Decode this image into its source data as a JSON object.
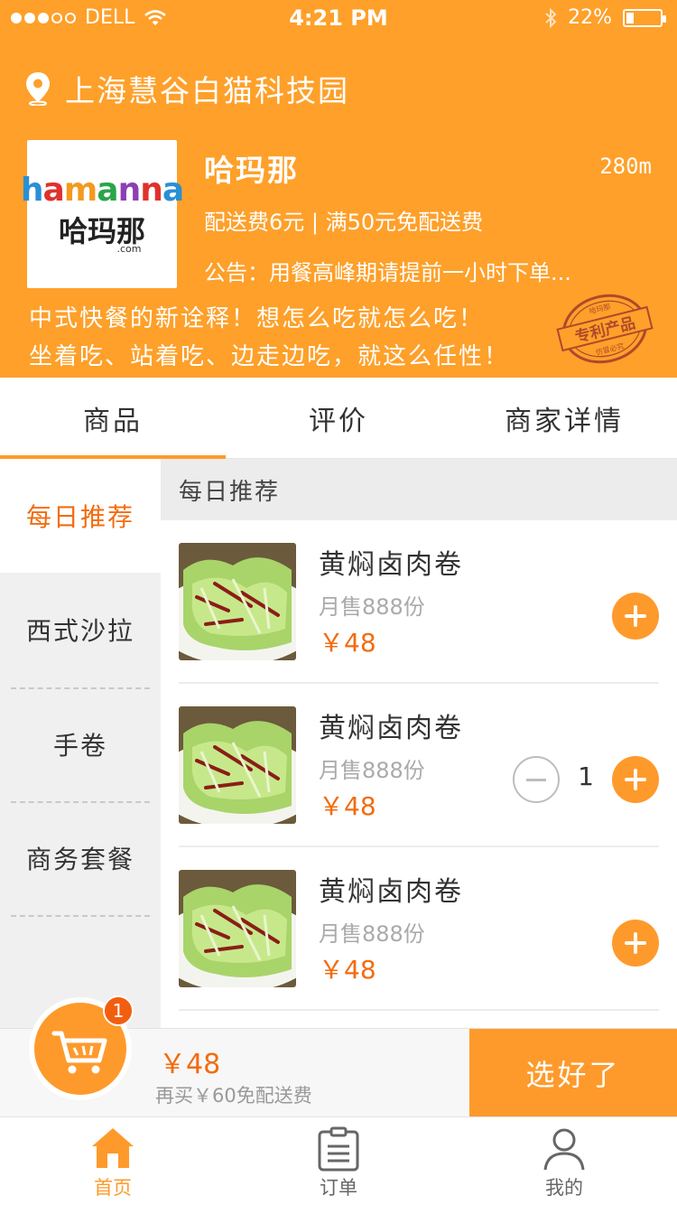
{
  "status_bar": {
    "carrier": "DELL",
    "time": "4:21 PM",
    "battery": "22%",
    "battery_level": 0.22,
    "signal_bars_filled": 3,
    "signal_bars_total": 5
  },
  "header": {
    "location": "上海慧谷白猫科技园",
    "shop": {
      "logo_text_latin": "hamanna",
      "logo_text_cn": "哈玛那",
      "logo_text_domain": ".com",
      "name": "哈玛那",
      "distance": "280m",
      "fee_info": "配送费6元 | 满50元免配送费",
      "notice": "公告：用餐高峰期请提前一小时下单..."
    },
    "slogan_line1": "中式快餐的新诠释！想怎么吃就怎么吃！",
    "slogan_line2": "坐着吃、站着吃、边走边吃，就这么任性！",
    "stamp_text": "专利产品",
    "stamp_small_top": "哈玛那",
    "stamp_small_bottom": "仿冒必究"
  },
  "tabs": [
    {
      "label": "商品",
      "active": true
    },
    {
      "label": "评价",
      "active": false
    },
    {
      "label": "商家详情",
      "active": false
    }
  ],
  "categories": [
    {
      "label": "每日推荐",
      "active": true
    },
    {
      "label": "西式沙拉",
      "active": false
    },
    {
      "label": "手卷",
      "active": false
    },
    {
      "label": "商务套餐",
      "active": false
    }
  ],
  "list": {
    "section_title": "每日推荐",
    "items": [
      {
        "name": "黄焖卤肉卷",
        "sold": "月售888份",
        "price": "￥48",
        "quantity": null
      },
      {
        "name": "黄焖卤肉卷",
        "sold": "月售888份",
        "price": "￥48",
        "quantity": "1"
      },
      {
        "name": "黄焖卤肉卷",
        "sold": "月售888份",
        "price": "￥48",
        "quantity": null
      }
    ]
  },
  "cart": {
    "badge": "1",
    "total": "￥48",
    "note": "再买￥60免配送费",
    "checkout_label": "选好了"
  },
  "bottom_nav": [
    {
      "label": "首页",
      "icon": "home-icon",
      "active": true
    },
    {
      "label": "订单",
      "icon": "order-icon",
      "active": false
    },
    {
      "label": "我的",
      "icon": "user-icon",
      "active": false
    }
  ],
  "colors": {
    "brand_orange": "#fea02a",
    "price_orange": "#f26c0e"
  }
}
